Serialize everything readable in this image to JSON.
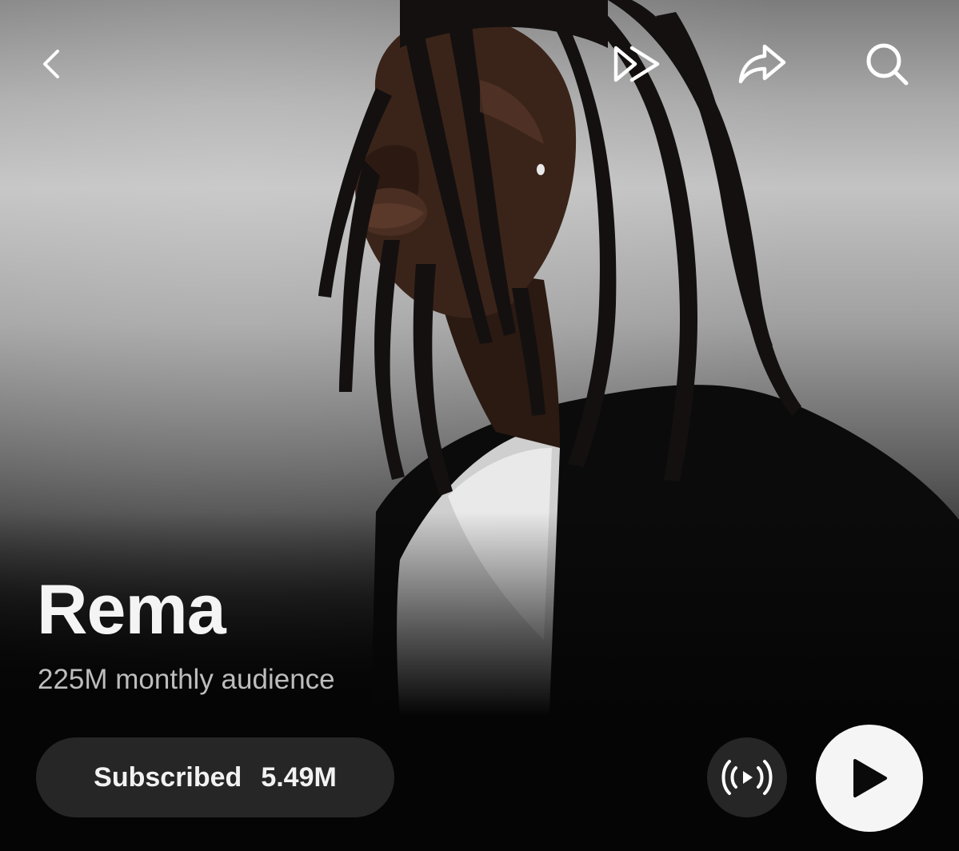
{
  "artist": {
    "name": "Rema",
    "audience": "225M monthly audience"
  },
  "top_bar": {
    "icons": [
      "chevron-left-icon",
      "skip-forward-icon",
      "share-icon",
      "search-icon"
    ]
  },
  "actions": {
    "subscribe_label": "Subscribed",
    "subscribe_count": "5.49M",
    "radio_icon": "broadcast-icon",
    "play_icon": "play-icon"
  },
  "colors": {
    "background": "#050505",
    "pill": "#262626",
    "play_button": "#f5f5f5",
    "text_primary": "#f4f4f4",
    "text_secondary": "#bdbdbd"
  }
}
